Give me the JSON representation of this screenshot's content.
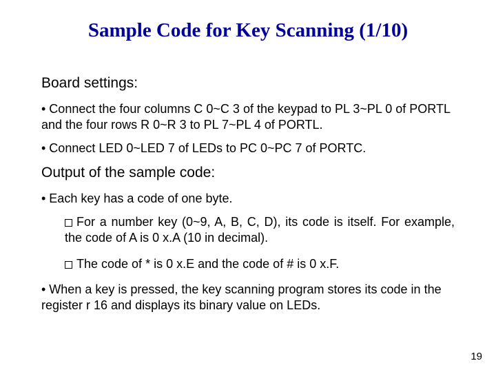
{
  "title": "Sample Code for Key Scanning (1/10)",
  "board_heading": "Board settings:",
  "board_b1": "• Connect the four columns C 0~C 3 of the keypad to PL 3~PL 0 of PORTL and the four rows R 0~R 3 to PL 7~PL 4 of PORTL.",
  "board_b2": "• Connect LED 0~LED 7 of LEDs to PC 0~PC 7 of PORTC.",
  "output_heading": "Output of the sample code:",
  "out_b1": "• Each key has a code of one byte.",
  "out_sub1": "For a number key (0~9, A, B, C, D), its code is itself. For example, the code of A is 0 x.A (10 in decimal).",
  "out_sub2": "The code of  * is 0 x.E and the code of # is 0 x.F.",
  "out_b2": "• When a key is pressed, the key scanning program stores its code in the register r 16 and displays its binary value on LEDs.",
  "page_num": "19"
}
